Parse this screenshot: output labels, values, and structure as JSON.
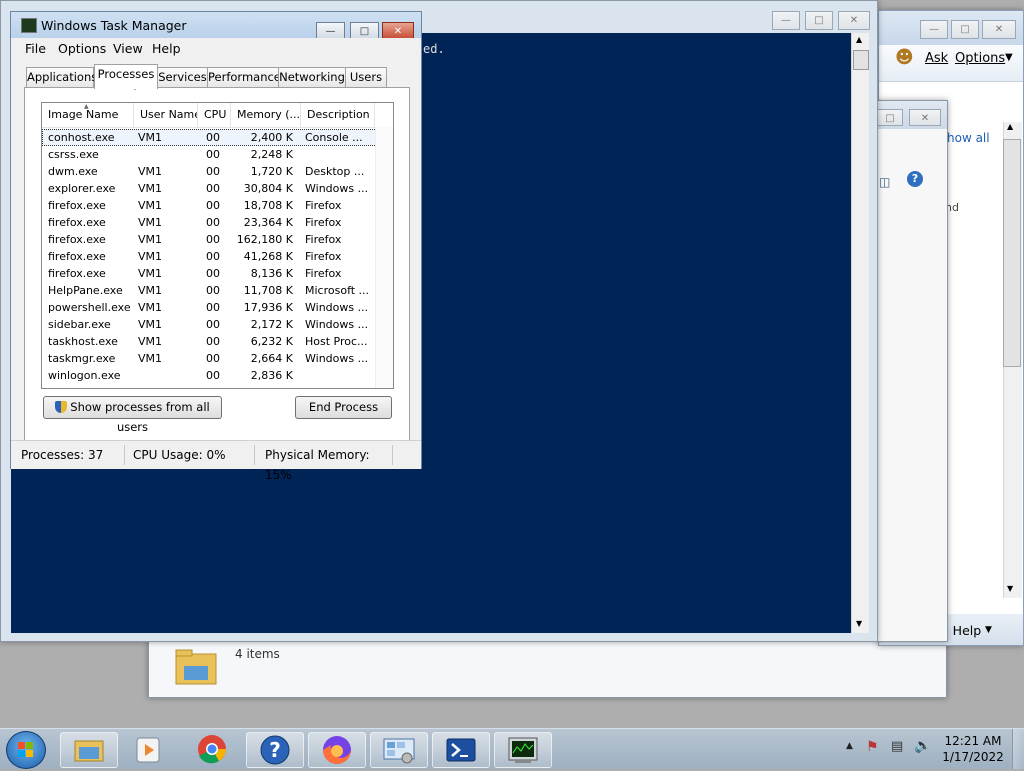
{
  "task_manager": {
    "title": "Windows Task Manager",
    "menu": [
      "File",
      "Options",
      "View",
      "Help"
    ],
    "tabs": [
      "Applications",
      "Processes",
      "Services",
      "Performance",
      "Networking",
      "Users"
    ],
    "active_tab": "Processes",
    "columns": [
      "Image Name",
      "User Name",
      "CPU",
      "Memory (...",
      "Description"
    ],
    "processes": [
      {
        "image": "conhost.exe",
        "user": "VM1",
        "cpu": "00",
        "memory": "2,400 K",
        "desc": "Console ..."
      },
      {
        "image": "csrss.exe",
        "user": "",
        "cpu": "00",
        "memory": "2,248 K",
        "desc": ""
      },
      {
        "image": "dwm.exe",
        "user": "VM1",
        "cpu": "00",
        "memory": "1,720 K",
        "desc": "Desktop ..."
      },
      {
        "image": "explorer.exe",
        "user": "VM1",
        "cpu": "00",
        "memory": "30,804 K",
        "desc": "Windows ..."
      },
      {
        "image": "firefox.exe",
        "user": "VM1",
        "cpu": "00",
        "memory": "18,708 K",
        "desc": "Firefox"
      },
      {
        "image": "firefox.exe",
        "user": "VM1",
        "cpu": "00",
        "memory": "23,364 K",
        "desc": "Firefox"
      },
      {
        "image": "firefox.exe",
        "user": "VM1",
        "cpu": "00",
        "memory": "162,180 K",
        "desc": "Firefox"
      },
      {
        "image": "firefox.exe",
        "user": "VM1",
        "cpu": "00",
        "memory": "41,268 K",
        "desc": "Firefox"
      },
      {
        "image": "firefox.exe",
        "user": "VM1",
        "cpu": "00",
        "memory": "8,136 K",
        "desc": "Firefox"
      },
      {
        "image": "HelpPane.exe",
        "user": "VM1",
        "cpu": "00",
        "memory": "11,708 K",
        "desc": "Microsoft ..."
      },
      {
        "image": "powershell.exe",
        "user": "VM1",
        "cpu": "00",
        "memory": "17,936 K",
        "desc": "Windows ..."
      },
      {
        "image": "sidebar.exe",
        "user": "VM1",
        "cpu": "00",
        "memory": "2,172 K",
        "desc": "Windows ..."
      },
      {
        "image": "taskhost.exe",
        "user": "VM1",
        "cpu": "00",
        "memory": "6,232 K",
        "desc": "Host Proc..."
      },
      {
        "image": "taskmgr.exe",
        "user": "VM1",
        "cpu": "00",
        "memory": "2,664 K",
        "desc": "Windows ..."
      },
      {
        "image": "winlogon.exe",
        "user": "",
        "cpu": "00",
        "memory": "2,836 K",
        "desc": ""
      }
    ],
    "show_all_label": "Show processes from all users",
    "end_process_label": "End Process",
    "status": {
      "processes": "Processes: 37",
      "cpu": "CPU Usage: 0%",
      "memory": "Physical Memory: 15%"
    }
  },
  "powershell": {
    "visible_text": "ed."
  },
  "help_window": {
    "ask_label": "Ask",
    "options_label": "Options",
    "show_all_label": "how all",
    "nd_text": "nd",
    "help_label": "e Help"
  },
  "explorer": {
    "items_count": "4 items"
  },
  "taskbar": {
    "time": "12:21 AM",
    "date": "1/17/2022",
    "buttons": [
      "start",
      "explorer",
      "media-player",
      "chrome",
      "help",
      "firefox",
      "control-panel",
      "powershell",
      "task-manager"
    ]
  },
  "colors": {
    "powershell_bg": "#012456",
    "selection": "#eef4fb",
    "desktop": "#aeaeae"
  }
}
